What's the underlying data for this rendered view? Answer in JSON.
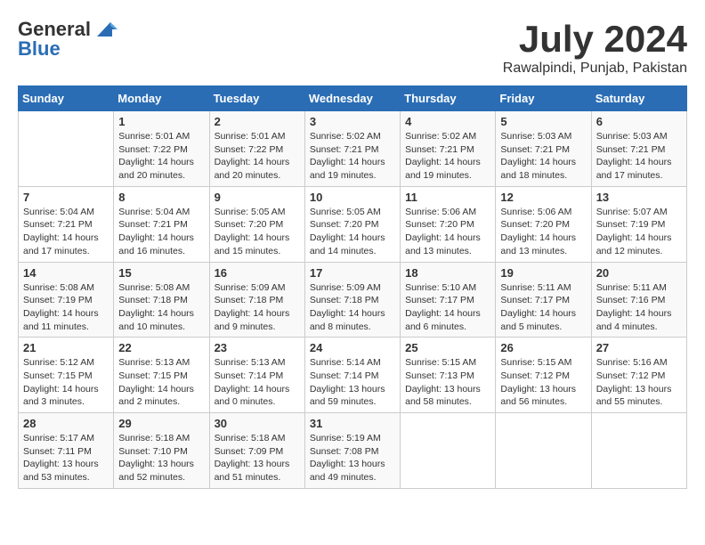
{
  "header": {
    "logo_general": "General",
    "logo_blue": "Blue",
    "month": "July 2024",
    "location": "Rawalpindi, Punjab, Pakistan"
  },
  "days_of_week": [
    "Sunday",
    "Monday",
    "Tuesday",
    "Wednesday",
    "Thursday",
    "Friday",
    "Saturday"
  ],
  "weeks": [
    [
      {
        "day": "",
        "info": ""
      },
      {
        "day": "1",
        "info": "Sunrise: 5:01 AM\nSunset: 7:22 PM\nDaylight: 14 hours\nand 20 minutes."
      },
      {
        "day": "2",
        "info": "Sunrise: 5:01 AM\nSunset: 7:22 PM\nDaylight: 14 hours\nand 20 minutes."
      },
      {
        "day": "3",
        "info": "Sunrise: 5:02 AM\nSunset: 7:21 PM\nDaylight: 14 hours\nand 19 minutes."
      },
      {
        "day": "4",
        "info": "Sunrise: 5:02 AM\nSunset: 7:21 PM\nDaylight: 14 hours\nand 19 minutes."
      },
      {
        "day": "5",
        "info": "Sunrise: 5:03 AM\nSunset: 7:21 PM\nDaylight: 14 hours\nand 18 minutes."
      },
      {
        "day": "6",
        "info": "Sunrise: 5:03 AM\nSunset: 7:21 PM\nDaylight: 14 hours\nand 17 minutes."
      }
    ],
    [
      {
        "day": "7",
        "info": "Sunrise: 5:04 AM\nSunset: 7:21 PM\nDaylight: 14 hours\nand 17 minutes."
      },
      {
        "day": "8",
        "info": "Sunrise: 5:04 AM\nSunset: 7:21 PM\nDaylight: 14 hours\nand 16 minutes."
      },
      {
        "day": "9",
        "info": "Sunrise: 5:05 AM\nSunset: 7:20 PM\nDaylight: 14 hours\nand 15 minutes."
      },
      {
        "day": "10",
        "info": "Sunrise: 5:05 AM\nSunset: 7:20 PM\nDaylight: 14 hours\nand 14 minutes."
      },
      {
        "day": "11",
        "info": "Sunrise: 5:06 AM\nSunset: 7:20 PM\nDaylight: 14 hours\nand 13 minutes."
      },
      {
        "day": "12",
        "info": "Sunrise: 5:06 AM\nSunset: 7:20 PM\nDaylight: 14 hours\nand 13 minutes."
      },
      {
        "day": "13",
        "info": "Sunrise: 5:07 AM\nSunset: 7:19 PM\nDaylight: 14 hours\nand 12 minutes."
      }
    ],
    [
      {
        "day": "14",
        "info": "Sunrise: 5:08 AM\nSunset: 7:19 PM\nDaylight: 14 hours\nand 11 minutes."
      },
      {
        "day": "15",
        "info": "Sunrise: 5:08 AM\nSunset: 7:18 PM\nDaylight: 14 hours\nand 10 minutes."
      },
      {
        "day": "16",
        "info": "Sunrise: 5:09 AM\nSunset: 7:18 PM\nDaylight: 14 hours\nand 9 minutes."
      },
      {
        "day": "17",
        "info": "Sunrise: 5:09 AM\nSunset: 7:18 PM\nDaylight: 14 hours\nand 8 minutes."
      },
      {
        "day": "18",
        "info": "Sunrise: 5:10 AM\nSunset: 7:17 PM\nDaylight: 14 hours\nand 6 minutes."
      },
      {
        "day": "19",
        "info": "Sunrise: 5:11 AM\nSunset: 7:17 PM\nDaylight: 14 hours\nand 5 minutes."
      },
      {
        "day": "20",
        "info": "Sunrise: 5:11 AM\nSunset: 7:16 PM\nDaylight: 14 hours\nand 4 minutes."
      }
    ],
    [
      {
        "day": "21",
        "info": "Sunrise: 5:12 AM\nSunset: 7:15 PM\nDaylight: 14 hours\nand 3 minutes."
      },
      {
        "day": "22",
        "info": "Sunrise: 5:13 AM\nSunset: 7:15 PM\nDaylight: 14 hours\nand 2 minutes."
      },
      {
        "day": "23",
        "info": "Sunrise: 5:13 AM\nSunset: 7:14 PM\nDaylight: 14 hours\nand 0 minutes."
      },
      {
        "day": "24",
        "info": "Sunrise: 5:14 AM\nSunset: 7:14 PM\nDaylight: 13 hours\nand 59 minutes."
      },
      {
        "day": "25",
        "info": "Sunrise: 5:15 AM\nSunset: 7:13 PM\nDaylight: 13 hours\nand 58 minutes."
      },
      {
        "day": "26",
        "info": "Sunrise: 5:15 AM\nSunset: 7:12 PM\nDaylight: 13 hours\nand 56 minutes."
      },
      {
        "day": "27",
        "info": "Sunrise: 5:16 AM\nSunset: 7:12 PM\nDaylight: 13 hours\nand 55 minutes."
      }
    ],
    [
      {
        "day": "28",
        "info": "Sunrise: 5:17 AM\nSunset: 7:11 PM\nDaylight: 13 hours\nand 53 minutes."
      },
      {
        "day": "29",
        "info": "Sunrise: 5:18 AM\nSunset: 7:10 PM\nDaylight: 13 hours\nand 52 minutes."
      },
      {
        "day": "30",
        "info": "Sunrise: 5:18 AM\nSunset: 7:09 PM\nDaylight: 13 hours\nand 51 minutes."
      },
      {
        "day": "31",
        "info": "Sunrise: 5:19 AM\nSunset: 7:08 PM\nDaylight: 13 hours\nand 49 minutes."
      },
      {
        "day": "",
        "info": ""
      },
      {
        "day": "",
        "info": ""
      },
      {
        "day": "",
        "info": ""
      }
    ]
  ]
}
